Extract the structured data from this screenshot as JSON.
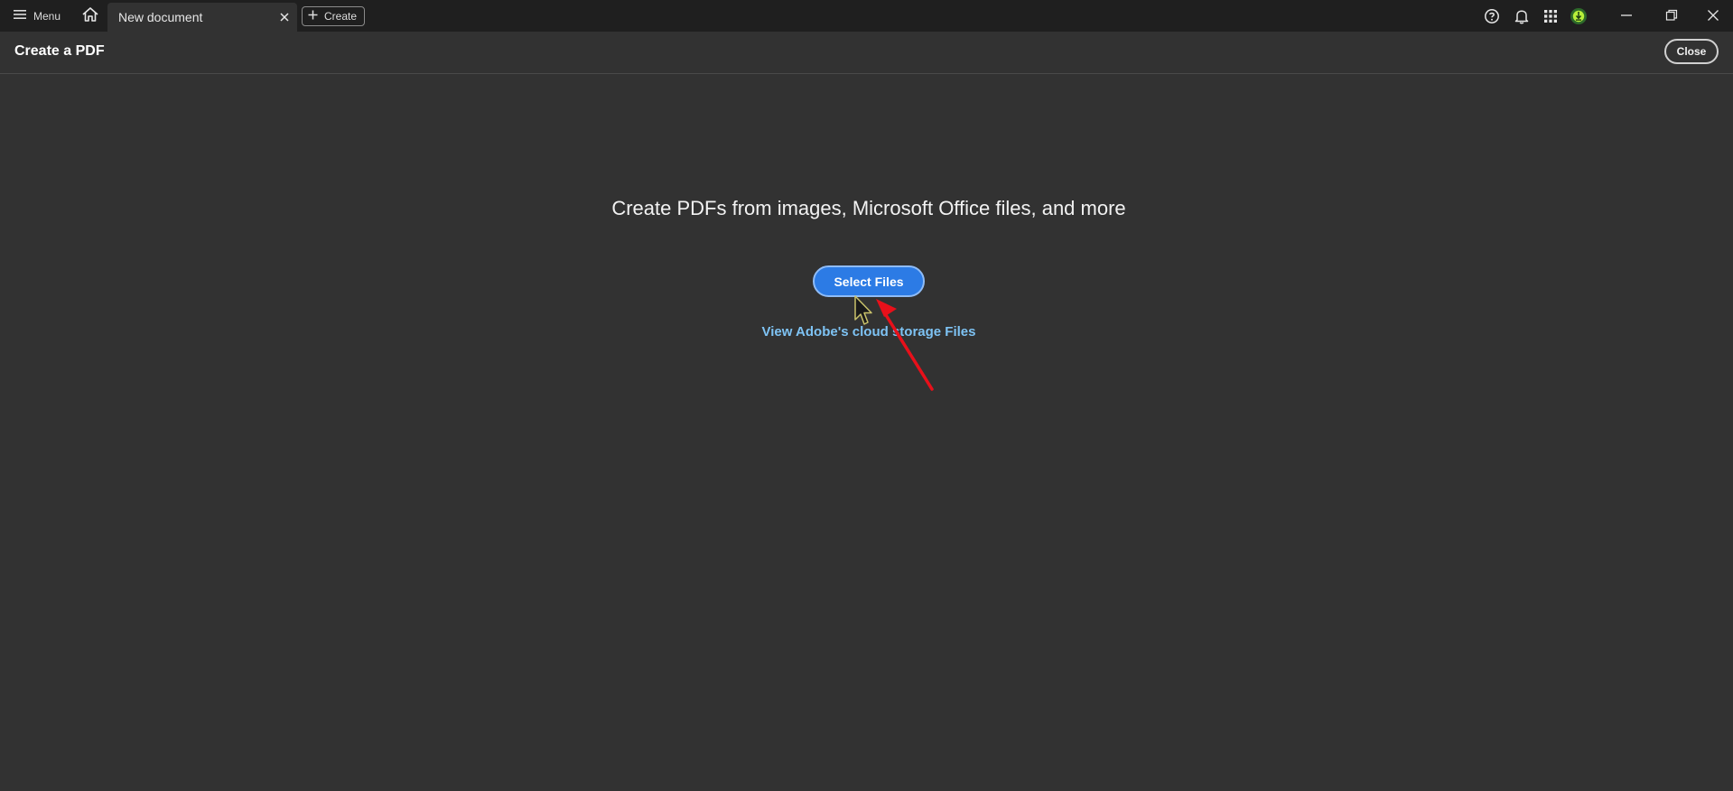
{
  "titlebar": {
    "menu_label": "Menu",
    "tab": {
      "label": "New document"
    },
    "create_label": "Create"
  },
  "header": {
    "title": "Create a PDF",
    "close_label": "Close"
  },
  "main": {
    "headline": "Create PDFs from images, Microsoft Office files, and more",
    "select_files_label": "Select Files",
    "cloud_link_label": "View Adobe's cloud storage Files"
  },
  "colors": {
    "titlebar_bg": "#1f1f1f",
    "page_bg": "#323232",
    "primary_button": "#2c7be5",
    "link": "#7ec3f4",
    "annotation_arrow": "#e8101a"
  },
  "icons": {
    "menu": "hamburger-icon",
    "home": "home-icon",
    "tab_close": "close-icon",
    "create": "plus-icon",
    "help": "help-icon",
    "notifications": "bell-icon",
    "apps": "apps-grid-icon",
    "account": "account-avatar-icon",
    "minimize": "minimize-icon",
    "restore": "restore-icon",
    "window_close": "close-icon"
  }
}
